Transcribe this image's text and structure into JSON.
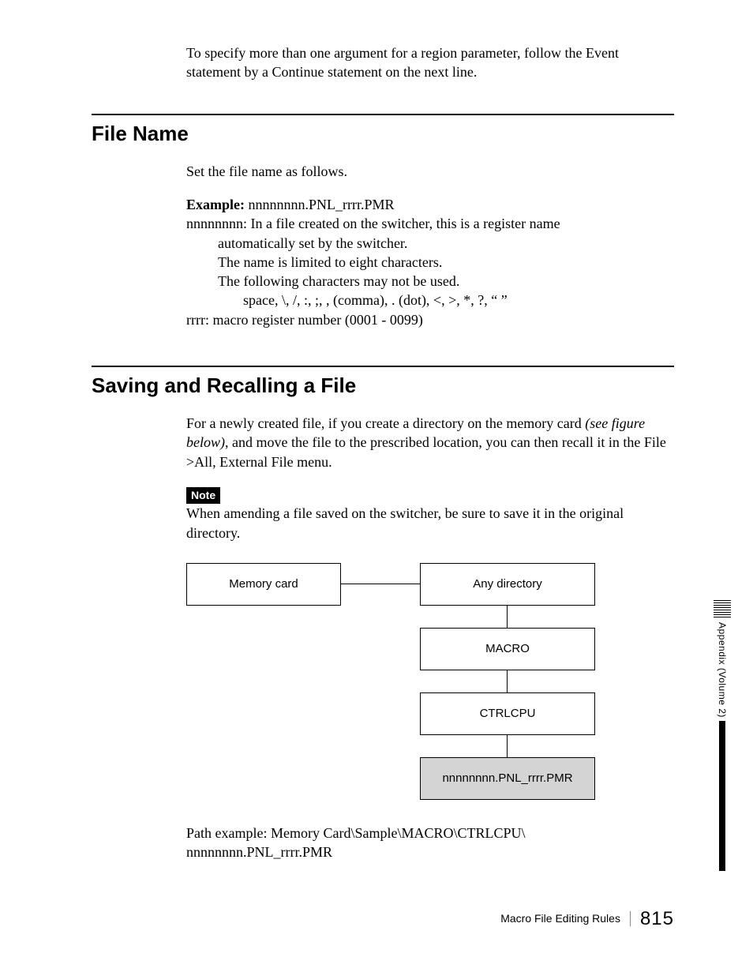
{
  "intro": "To specify more than one argument for a region parameter, follow the Event statement by a Continue statement on the next line.",
  "section1": {
    "title": "File Name",
    "lead": "Set the file name as follows.",
    "example_label": "Example:",
    "example_value": " nnnnnnnn.PNL_rrrr.PMR",
    "line1": "nnnnnnnn: In a file created on the switcher, this is a register name",
    "line1_cont": "automatically set by the switcher.",
    "line2": "The name is limited to eight characters.",
    "line3": "The following characters may not be used.",
    "line4": "space, \\, /, :, ;, , (comma), . (dot), <, >, *, ?, “ ”",
    "line5": "rrrr: macro register number (0001 - 0099)"
  },
  "section2": {
    "title": "Saving and Recalling a File",
    "para_a": "For a newly created file, if you create a directory on the memory card ",
    "para_b_italic": "(see figure below)",
    "para_c": ", and move the file to the prescribed location, you can then recall it in the File >All, External File menu.",
    "note_label": "Note",
    "note_text": "When amending a file saved on the switcher, be sure to save it in the original directory.",
    "path_line1": "Path example: Memory Card\\Sample\\MACRO\\CTRLCPU\\",
    "path_line2": "nnnnnnnn.PNL_rrrr.PMR"
  },
  "diagram": {
    "memory_card": "Memory card",
    "any_dir": "Any directory",
    "macro": "MACRO",
    "ctrlcpu": "CTRLCPU",
    "filename": "nnnnnnnn.PNL_rrrr.PMR"
  },
  "sidetab": "Appendix (Volume 2)",
  "footer": {
    "title": "Macro File Editing Rules",
    "page": "815"
  }
}
